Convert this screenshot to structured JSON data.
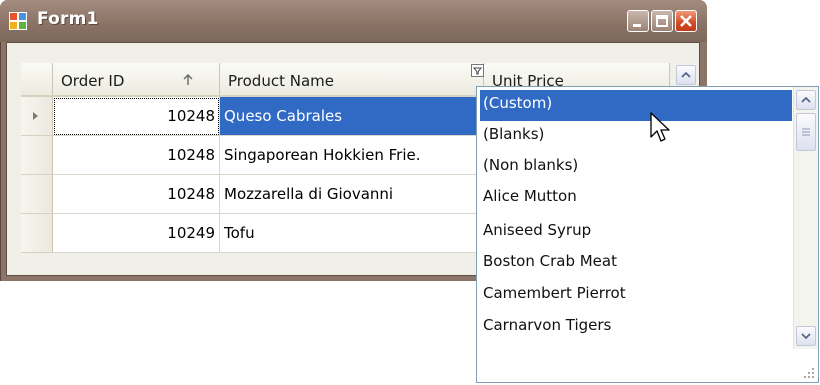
{
  "window": {
    "title": "Form1"
  },
  "grid": {
    "columns": [
      {
        "label": "Order ID",
        "sort": "ascending"
      },
      {
        "label": "Product Name"
      },
      {
        "label": "Unit Price"
      }
    ],
    "rows": [
      {
        "order_id": "10248",
        "product": "Queso Cabrales",
        "selected": true
      },
      {
        "order_id": "10248",
        "product": "Singaporean Hokkien Frie."
      },
      {
        "order_id": "10248",
        "product": "Mozzarella di Giovanni"
      },
      {
        "order_id": "10249",
        "product": "Tofu"
      }
    ]
  },
  "filter_dropdown": {
    "items": [
      "(Custom)",
      "(Blanks)",
      "(Non blanks)",
      "Alice Mutton",
      "Aniseed Syrup",
      "Boston Crab Meat",
      "Camembert Pierrot",
      "Carnarvon Tigers"
    ],
    "highlighted_index": 0
  },
  "icons": {
    "app": "form-app-icon",
    "minimize": "minimize-icon",
    "maximize": "maximize-icon",
    "close": "close-icon",
    "sort": "sort-ascending-icon",
    "filter": "filter-icon",
    "row_indicator": "row-indicator-icon",
    "cursor": "mouse-pointer-icon"
  },
  "colors": {
    "title_bar": "#8c7568",
    "close_button": "#d24a25",
    "selection": "#316ac5"
  }
}
